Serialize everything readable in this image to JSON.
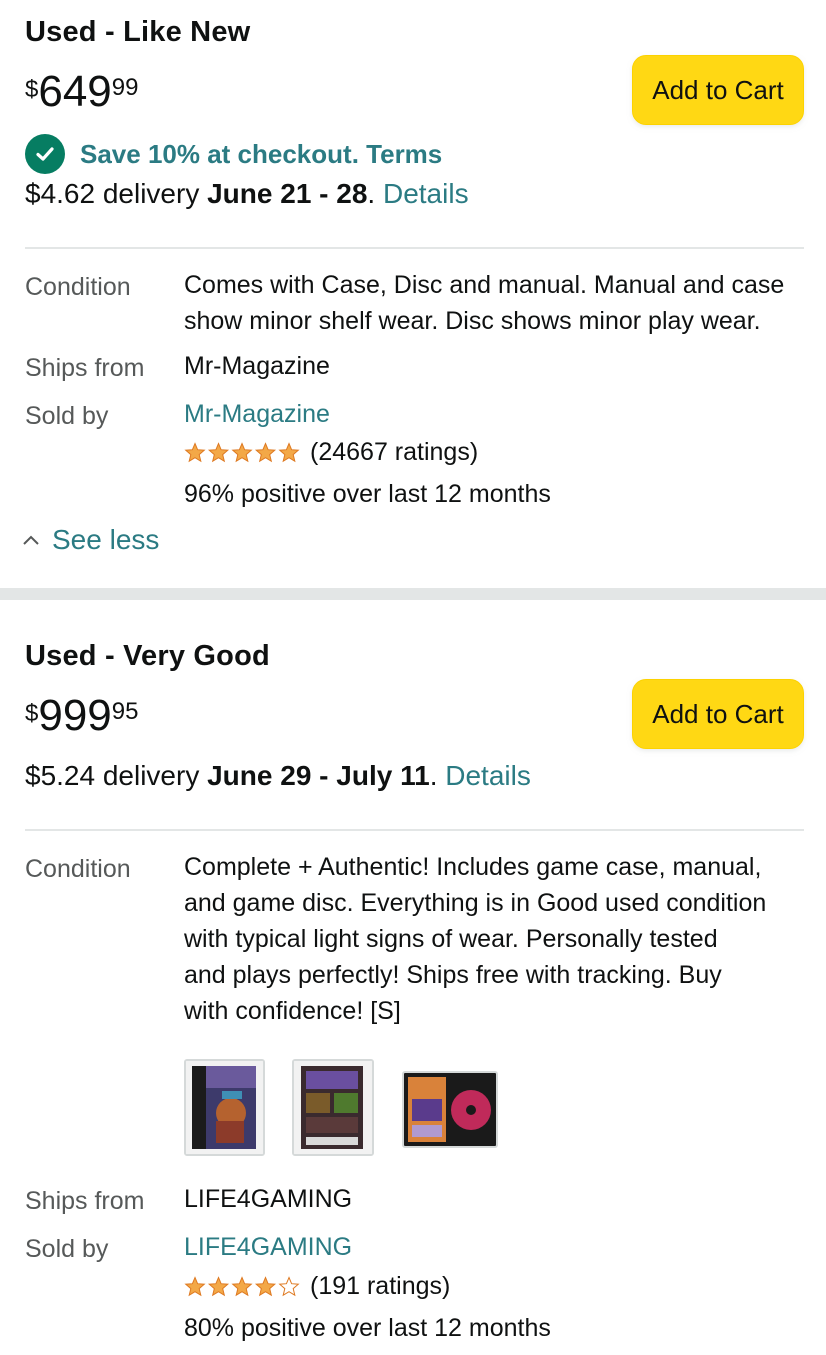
{
  "offers": [
    {
      "condition_title": "Used - Like New",
      "price": {
        "symbol": "$",
        "whole": "649",
        "fraction": "99"
      },
      "add_to_cart_label": "Add to Cart",
      "save_text": "Save 10% at checkout.",
      "save_terms": "Terms",
      "delivery": {
        "prefix": "$4.62 delivery ",
        "dates": "June 21 - 28",
        "suffix": ". ",
        "details_label": "Details"
      },
      "condition_label": "Condition",
      "condition_lines": [
        "Comes with Case, Disc and manual. Manual and case",
        "show minor shelf wear. Disc shows minor play wear."
      ],
      "ships_from_label": "Ships from",
      "ships_from": "Mr-Magazine",
      "sold_by_label": "Sold by",
      "sold_by": "Mr-Magazine",
      "rating": 5,
      "ratings_text": "(24667 ratings)",
      "positive_text": "96% positive over last 12 months",
      "see_less_label": "See less"
    },
    {
      "condition_title": "Used - Very Good",
      "price": {
        "symbol": "$",
        "whole": "999",
        "fraction": "95"
      },
      "add_to_cart_label": "Add to Cart",
      "delivery": {
        "prefix": "$5.24 delivery ",
        "dates": "June 29 - July 11",
        "suffix": ". ",
        "details_label": "Details"
      },
      "condition_label": "Condition",
      "condition_lines": [
        "Complete + Authentic! Includes game case, manual,",
        "and game disc. Everything is in Good used condition",
        "with typical light signs of wear. Personally tested",
        "and plays perfectly! Ships free with tracking. Buy",
        "with confidence! [S]"
      ],
      "ships_from_label": "Ships from",
      "ships_from": "LIFE4GAMING",
      "sold_by_label": "Sold by",
      "sold_by": "LIFE4GAMING",
      "rating": 4.5,
      "ratings_text": "(191 ratings)",
      "positive_text": "80% positive over last 12 months",
      "photos": [
        "case-front-photo",
        "case-back-photo",
        "open-case-disc-photo"
      ]
    }
  ],
  "colors": {
    "link": "#2b7b83",
    "button": "#ffd814",
    "check": "#067d62",
    "star": "#f3a847"
  }
}
